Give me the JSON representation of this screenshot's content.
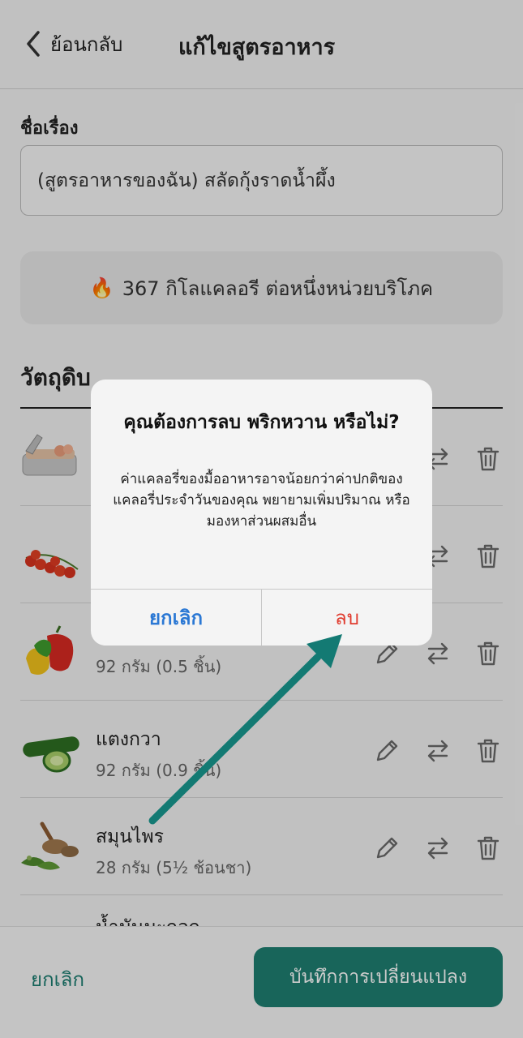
{
  "header": {
    "back_label": "ย้อนกลับ",
    "title": "แก้ไขสูตรอาหาร"
  },
  "name_field": {
    "label": "ชื่อเรื่อง",
    "value": "(สูตรอาหารของฉัน) สลัดกุ้งราดน้ำผึ้ง"
  },
  "calorie": {
    "icon": "🔥",
    "text": "367 กิโลแคลอรี ต่อหนึ่งหน่วยบริโภค"
  },
  "ingredients": {
    "title": "วัตถุดิบ",
    "items": [
      {
        "name": "",
        "amount": "",
        "image": "canned-shrimp"
      },
      {
        "name": "",
        "amount": "",
        "image": "cherry-tomatoes"
      },
      {
        "name": "",
        "amount": "92 กรัม (0.5 ชิ้น)",
        "image": "bell-peppers"
      },
      {
        "name": "แตงกวา",
        "amount": "92 กรัม (0.9 ชิ้น)",
        "image": "cucumber"
      },
      {
        "name": "สมุนไพร",
        "amount": "28 กรัม (5½ ช้อนชา)",
        "image": "herbs"
      },
      {
        "name": "น้ำมันมะกอก",
        "amount": "",
        "image": "olive-oil"
      }
    ]
  },
  "bottom_bar": {
    "cancel_label": "ยกเลิก",
    "save_label": "บันทึกการเปลี่ยนแปลง"
  },
  "dialog": {
    "title": "คุณต้องการลบ พริกหวาน หรือไม่?",
    "message": "ค่าแคลอรี่ของมื้ออาหารอาจน้อยกว่าค่าปกติของแคลอรี่ประจำวันของคุณ พยายามเพิ่มปริมาณ หรือมองหาส่วนผสมอื่น",
    "cancel_label": "ยกเลิก",
    "delete_label": "ลบ"
  },
  "colors": {
    "accent": "#1f7f71",
    "dialog_cancel": "#2b78d4",
    "dialog_delete": "#e03b2e",
    "arrow": "#137a73"
  }
}
